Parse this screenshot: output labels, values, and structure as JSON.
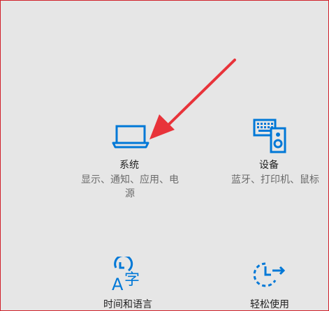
{
  "tiles": {
    "system": {
      "title": "系统",
      "desc_line1": "显示、通知、应用、电",
      "desc_line2": "源",
      "icon": "laptop-icon"
    },
    "devices": {
      "title": "设备",
      "desc": "蓝牙、打印机、鼠标",
      "icon": "keyboard-speaker-icon"
    },
    "time_language": {
      "title": "时间和语言",
      "icon": "clock-language-icon"
    },
    "ease_of_access": {
      "title": "轻松使用",
      "icon": "ease-of-access-icon"
    }
  },
  "colors": {
    "accent": "#0078d7",
    "annotation_arrow": "#e8333a",
    "frame_border": "#d0202a",
    "background": "#e6e6e6"
  }
}
